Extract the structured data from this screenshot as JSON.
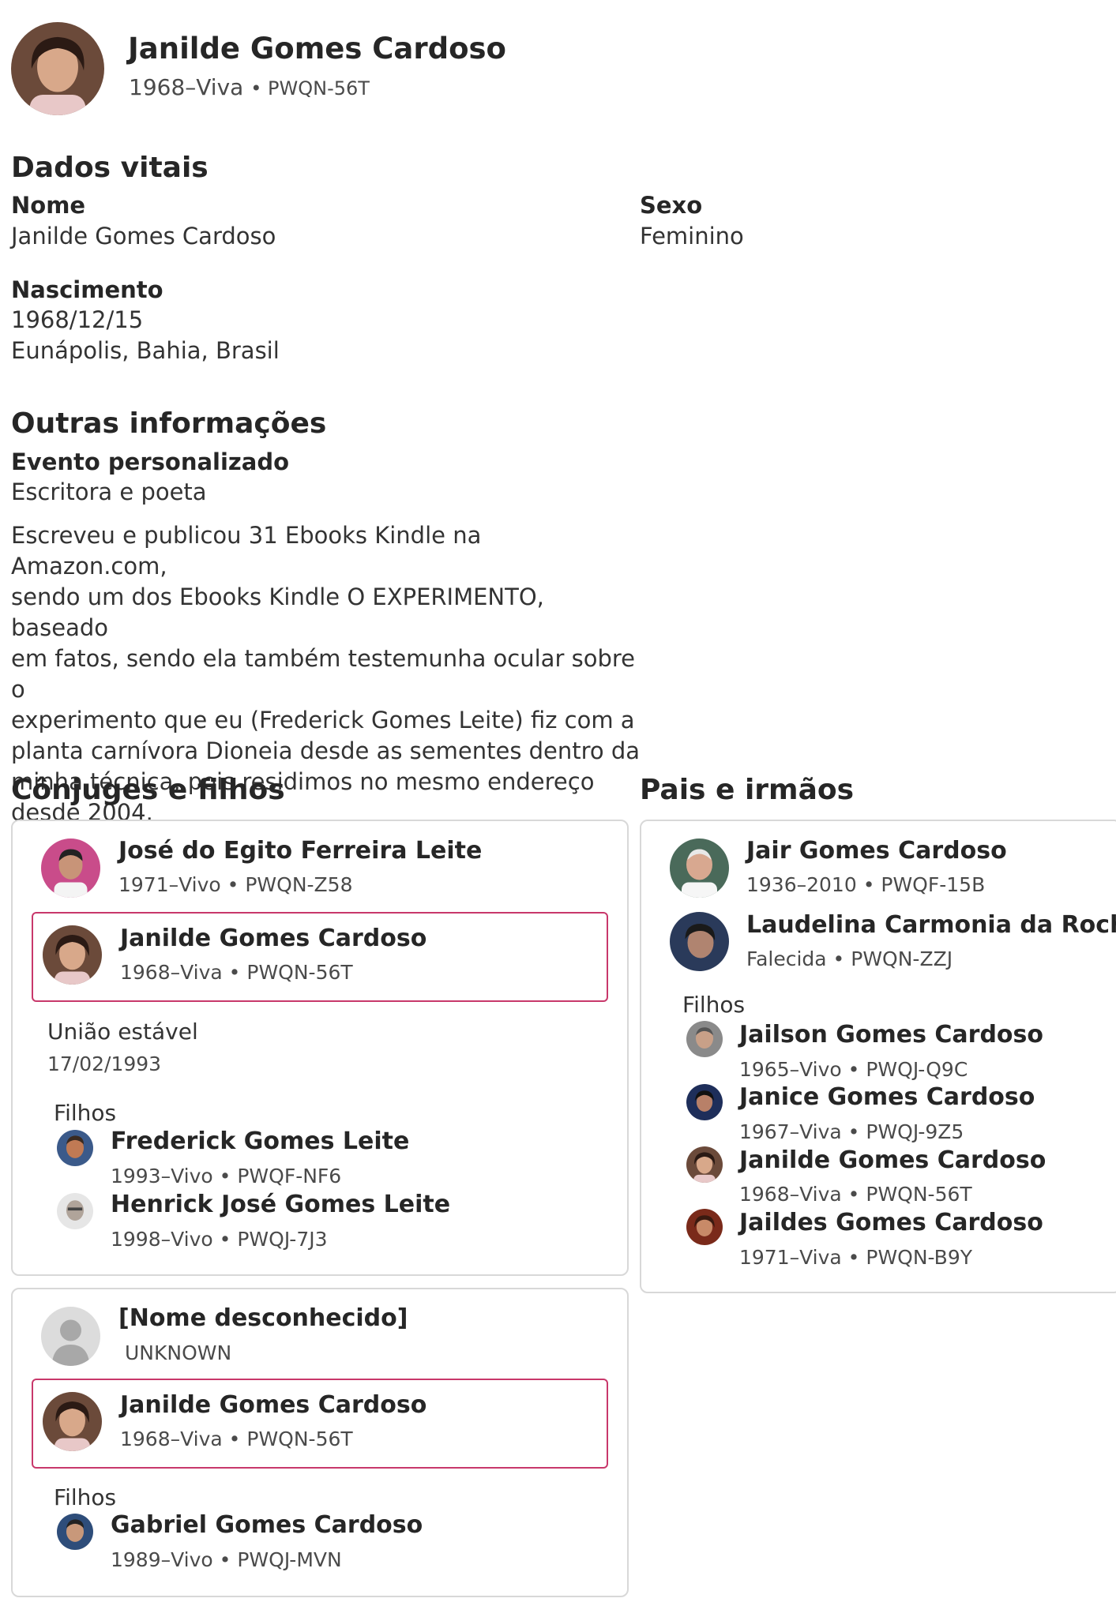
{
  "header": {
    "name": "Janilde Gomes Cardoso",
    "years": "1968–Viva",
    "id": "PWQN-56T"
  },
  "vitals": {
    "title": "Dados vitais",
    "name_label": "Nome",
    "name_value": "Janilde Gomes Cardoso",
    "sex_label": "Sexo",
    "sex_value": "Feminino",
    "birth_label": "Nascimento",
    "birth_date": "1968/12/15",
    "birth_place": "Eunápolis, Bahia, Brasil"
  },
  "other": {
    "title": "Outras informações",
    "event_label": "Evento personalizado",
    "event_value": "Escritora e poeta",
    "description_lines": [
      "Escreveu e publicou 31 Ebooks Kindle na Amazon.com,",
      "sendo um dos Ebooks Kindle O EXPERIMENTO, baseado",
      "em fatos, sendo ela também testemunha ocular sobre o",
      "experimento que eu (Frederick Gomes Leite) fiz com a",
      "planta carnívora Dioneia desde as sementes dentro da",
      "minha técnica, pois residimos no mesmo endereço",
      "desde 2004."
    ]
  },
  "spouses": {
    "title": "Cônjuges e filhos",
    "families": [
      {
        "spouse": {
          "name": "José do Egito Ferreira Leite",
          "meta": "1971–Vivo • PWQN-Z58"
        },
        "self": {
          "name": "Janilde Gomes Cardoso",
          "meta": "1968–Viva • PWQN-56T"
        },
        "relationship": "União estável",
        "relationship_date": "17/02/1993",
        "children_label": "Filhos",
        "children": [
          {
            "name": "Frederick Gomes Leite",
            "meta": "1993–Vivo • PWQF-NF6"
          },
          {
            "name": "Henrick José Gomes Leite",
            "meta": "1998–Vivo • PWQJ-7J3"
          }
        ]
      },
      {
        "spouse": {
          "name": "[Nome desconhecido]",
          "meta": "UNKNOWN"
        },
        "self": {
          "name": "Janilde Gomes Cardoso",
          "meta": "1968–Viva • PWQN-56T"
        },
        "children_label": "Filhos",
        "children": [
          {
            "name": "Gabriel Gomes Cardoso",
            "meta": "1989–Vivo • PWQJ-MVN"
          }
        ]
      }
    ]
  },
  "parents": {
    "title": "Pais e irmãos",
    "father": {
      "name": "Jair Gomes Cardoso",
      "meta": "1936–2010 • PWQF-15B"
    },
    "mother": {
      "name": "Laudelina Carmonia da Rocha",
      "meta": "Falecida • PWQN-ZZJ"
    },
    "children_label": "Filhos",
    "children": [
      {
        "name": "Jailson Gomes Cardoso",
        "meta": "1965–Vivo • PWQJ-Q9C"
      },
      {
        "name": "Janice Gomes Cardoso",
        "meta": "1967–Viva • PWQJ-9Z5"
      },
      {
        "name": "Janilde Gomes Cardoso",
        "meta": "1968–Viva • PWQN-56T"
      },
      {
        "name": "Jaildes Gomes Cardoso",
        "meta": "1971–Viva • PWQN-B9Y"
      }
    ]
  },
  "colors": {
    "highlight_border": "#c8386b",
    "card_border": "#d8d8d8"
  }
}
